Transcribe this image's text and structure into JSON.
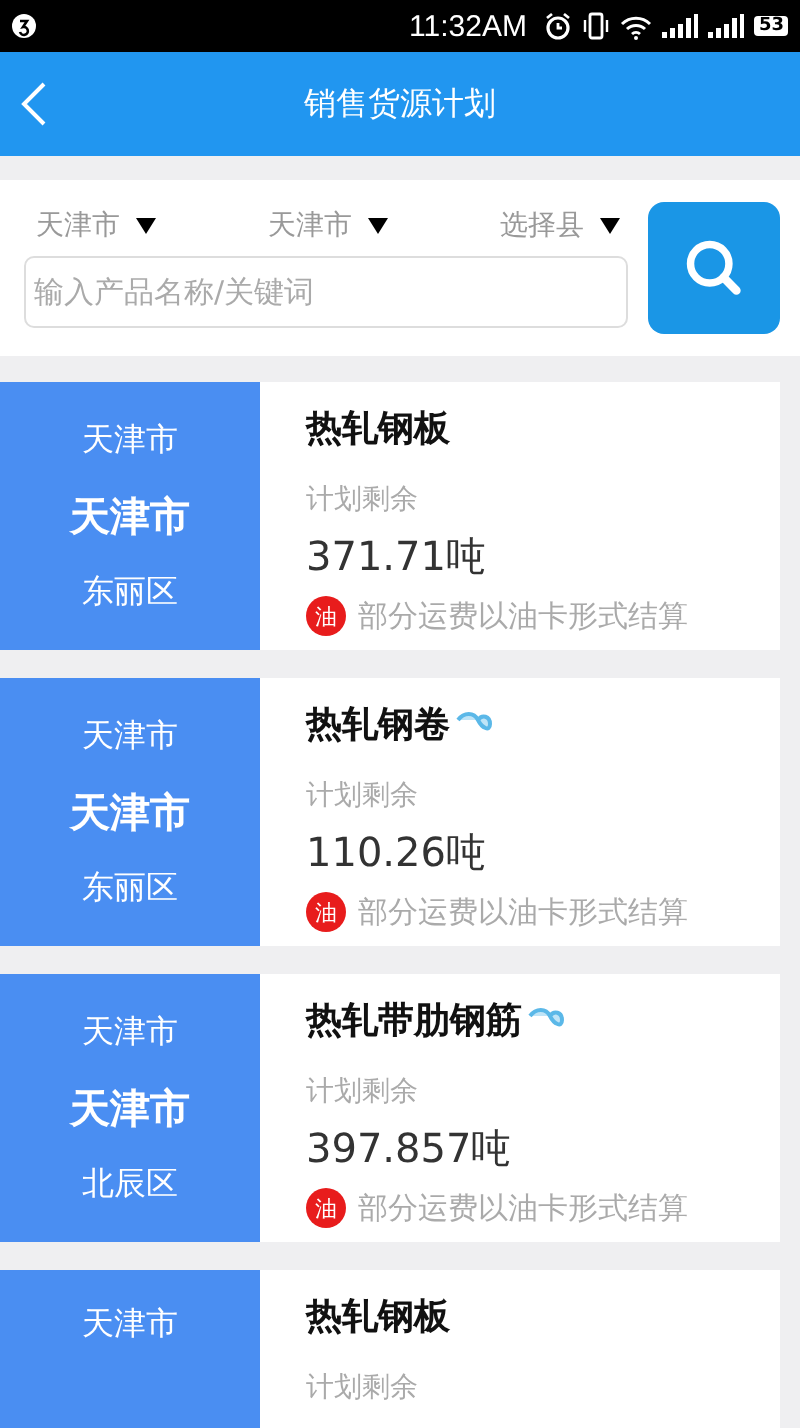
{
  "status_bar": {
    "time": "11:32AM",
    "battery": "53"
  },
  "header": {
    "title": "销售货源计划"
  },
  "filters": [
    {
      "label": "天津市"
    },
    {
      "label": "天津市"
    },
    {
      "label": "选择县"
    }
  ],
  "search": {
    "placeholder": "输入产品名称/关键词"
  },
  "plans": [
    {
      "province": "天津市",
      "city": "天津市",
      "district": "东丽区",
      "product": "热轧钢板",
      "flagged": false,
      "remaining_label": "计划剩余",
      "amount": "371.71吨",
      "badge": "油",
      "note": "部分运费以油卡形式结算"
    },
    {
      "province": "天津市",
      "city": "天津市",
      "district": "东丽区",
      "product": "热轧钢卷",
      "flagged": true,
      "remaining_label": "计划剩余",
      "amount": "110.26吨",
      "badge": "油",
      "note": "部分运费以油卡形式结算"
    },
    {
      "province": "天津市",
      "city": "天津市",
      "district": "北辰区",
      "product": "热轧带肋钢筋",
      "flagged": true,
      "remaining_label": "计划剩余",
      "amount": "397.857吨",
      "badge": "油",
      "note": "部分运费以油卡形式结算"
    },
    {
      "province": "天津市",
      "product": "热轧钢板",
      "flagged": false,
      "remaining_label": "计划剩余"
    }
  ]
}
